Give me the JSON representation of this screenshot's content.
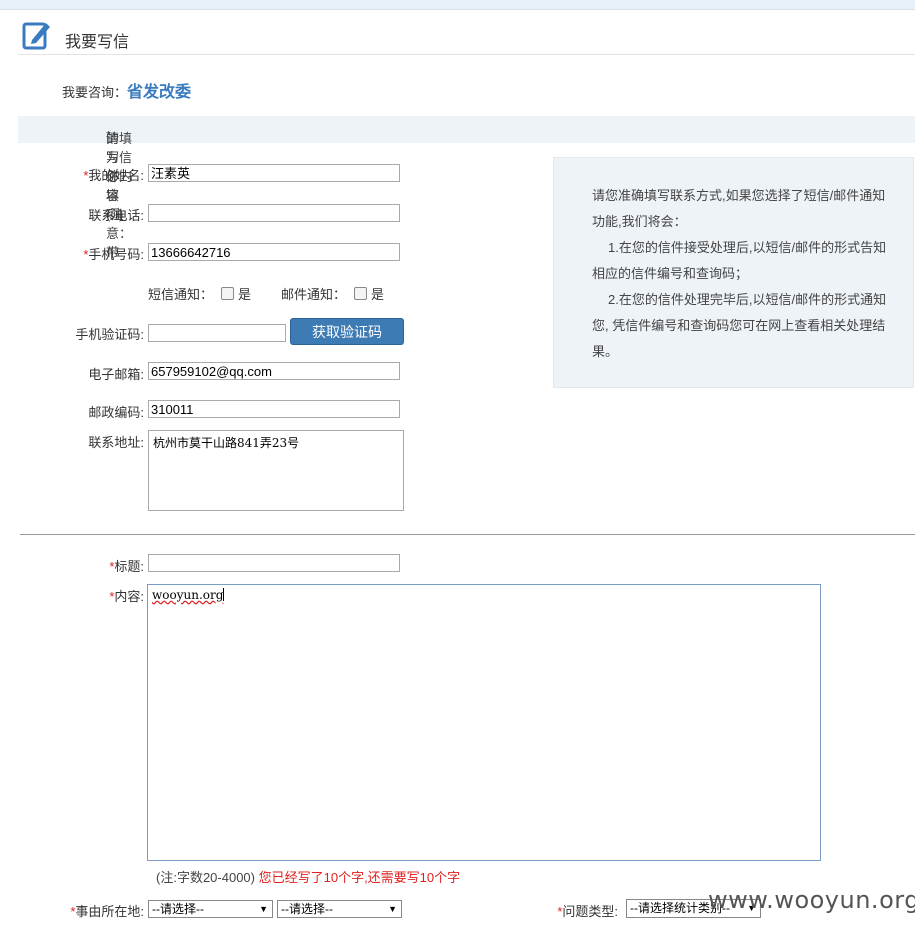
{
  "header": {
    "title": "我要写信",
    "icon": "edit-icon"
  },
  "consult": {
    "label": "我要咨询：",
    "org": "省发改委"
  },
  "notice": {
    "prefix": "请填写信件内容(注意：带",
    "star": "*",
    "suffix": "的为必填项)"
  },
  "form": {
    "name_label": "我的姓名:",
    "name_value": "汪素英",
    "phone_label": "联系电话:",
    "phone_value": "",
    "mobile_label": "手机号码:",
    "mobile_value": "13666642716",
    "sms_label": "短信通知：",
    "sms_yes": "是",
    "mail_label": "邮件通知：",
    "mail_yes": "是",
    "code_label": "手机验证码:",
    "code_value": "",
    "code_button": "获取验证码",
    "email_label": "电子邮箱:",
    "email_value": "657959102@qq.com",
    "zip_label": "邮政编码:",
    "zip_value": "310011",
    "addr_label": "联系地址:",
    "addr_value": "杭州市莫干山路841弄23号",
    "title_label": "标题:",
    "title_value": "",
    "content_label": "内容:",
    "content_value": "wooyun.org",
    "hint_normal": "(注:字数20-4000)",
    "hint_red": "您已经写了10个字,还需要写10个字",
    "location_label": "事由所在地:",
    "location_select1": "--请选择--",
    "location_select2": "--请选择--",
    "type_label": "问题类型:",
    "type_select": "--请选择统计类别--"
  },
  "info": {
    "line1": "请您准确填写联系方式,如果您选择了短信/邮件通知功能,我们将会：",
    "line2": "1.在您的信件接受处理后,以短信/邮件的形式告知相应的信件编号和查询码；",
    "line3": "2.在您的信件处理完毕后,以短信/邮件的形式通知您, 凭信件编号和查询码您可在网上查看相关处理结果。"
  },
  "watermark": "www.wooyun.org",
  "colors": {
    "accent": "#3d7bb5",
    "required": "#e02020",
    "panel": "#eef3f8"
  }
}
